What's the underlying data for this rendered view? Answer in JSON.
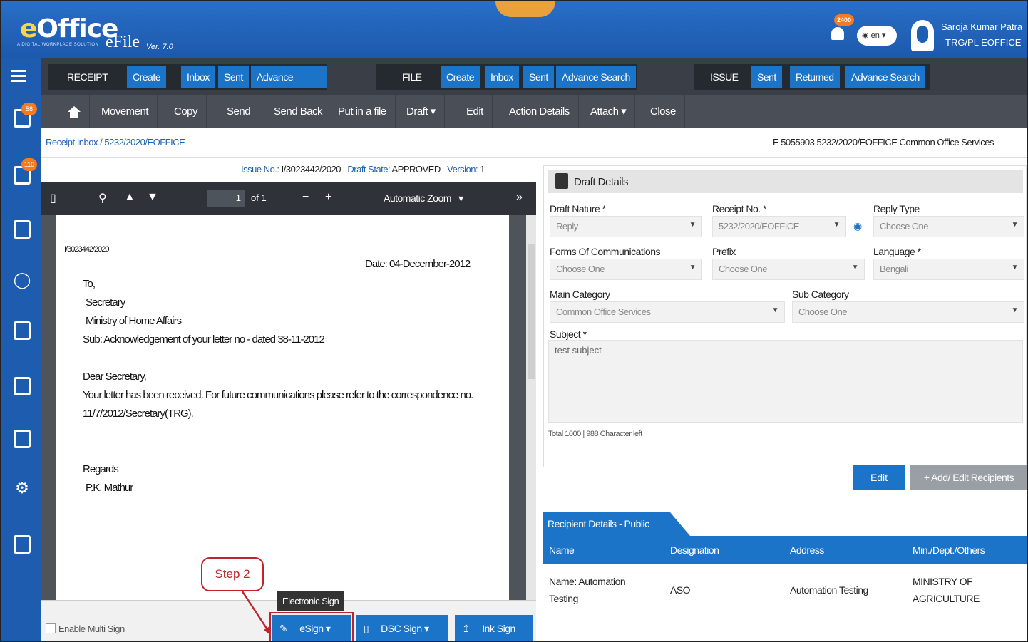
{
  "header": {
    "logo": "eOffice",
    "logo_sub": "A DIGITAL WORKPLACE SOLUTION",
    "app": "eFile",
    "version": "Ver. 7.0",
    "notif_count": "2400",
    "lang": "en",
    "user_name": "Saroja Kumar Patra",
    "user_org": "TRG/PL EOFFICE"
  },
  "sidebar": {
    "badges": [
      "58",
      "110"
    ]
  },
  "modules": {
    "receipt": {
      "label": "RECEIPT",
      "items": [
        "Create",
        "Inbox",
        "Sent",
        "Advance Search"
      ]
    },
    "file": {
      "label": "FILE",
      "items": [
        "Create",
        "Inbox",
        "Sent",
        "Advance Search"
      ]
    },
    "issue": {
      "label": "ISSUE",
      "items": [
        "Sent",
        "Returned",
        "Advance Search"
      ]
    }
  },
  "actions": [
    "Movement",
    "Copy",
    "Send",
    "Send Back",
    "Put in a file",
    "Draft",
    "Edit",
    "Action Details",
    "Attach",
    "Close"
  ],
  "breadcrumb": {
    "inbox": "Receipt Inbox",
    "sep": "/",
    "current": "5232/2020/EOFFICE",
    "right": "E  5055903  5232/2020/EOFFICE  Common Office Services"
  },
  "doc": {
    "issue_label": "Issue No.:",
    "issue_no": "I/3023442/2020",
    "state_label": "Draft State:",
    "state": "APPROVED",
    "version_label": "Version:",
    "version": "1",
    "page_current": "1",
    "page_total": "of 1",
    "zoom": "Automatic Zoom",
    "ref": "I/3023442/2020",
    "date": "Date: 04-December-2012",
    "to": "To,",
    "recipient": "Secretary",
    "ministry": "Ministry of Home Affairs",
    "subject": "Sub: Acknowledgement of your letter no - dated 38-11-2012",
    "salutation": "Dear Secretary,",
    "body1": "Your letter has been received. For future communications please refer to the correspondence no.",
    "body2": "11/7/2012/Secretary(TRG).",
    "regards": "Regards",
    "signer": "P.K. Mathur"
  },
  "signing": {
    "multi_sign": "Enable Multi Sign",
    "esign": "eSign",
    "dsc": "DSC Sign",
    "ink": "Ink Sign",
    "tooltip": "Electronic Sign",
    "step": "Step 2"
  },
  "draft": {
    "title": "Draft Details",
    "draft_nature_label": "Draft Nature *",
    "draft_nature": "Reply",
    "receipt_no_label": "Receipt No. *",
    "receipt_no": "5232/2020/EOFFICE",
    "reply_type_label": "Reply Type",
    "reply_type": "Choose One",
    "forms_label": "Forms Of Communications",
    "forms": "Choose One",
    "prefix_label": "Prefix",
    "prefix": "Choose One",
    "language_label": "Language *",
    "language": "Bengali",
    "main_cat_label": "Main Category",
    "main_cat": "Common Office Services",
    "sub_cat_label": "Sub Category",
    "sub_cat": "Choose One",
    "subject_label": "Subject *",
    "subject": "test subject",
    "char_left": "Total 1000 | 988 Character left",
    "edit": "Edit",
    "add_recipients": "+ Add/ Edit Recipients"
  },
  "recipients": {
    "tab": "Recipient Details - Public",
    "columns": [
      "Name",
      "Designation",
      "Address",
      "Min./Dept./Others"
    ],
    "rows": [
      {
        "name1": "Name: Automation",
        "name2": "Testing",
        "designation": "ASO",
        "address": "Automation Testing",
        "min1": "MINISTRY OF",
        "min2": "AGRICULTURE"
      }
    ]
  }
}
